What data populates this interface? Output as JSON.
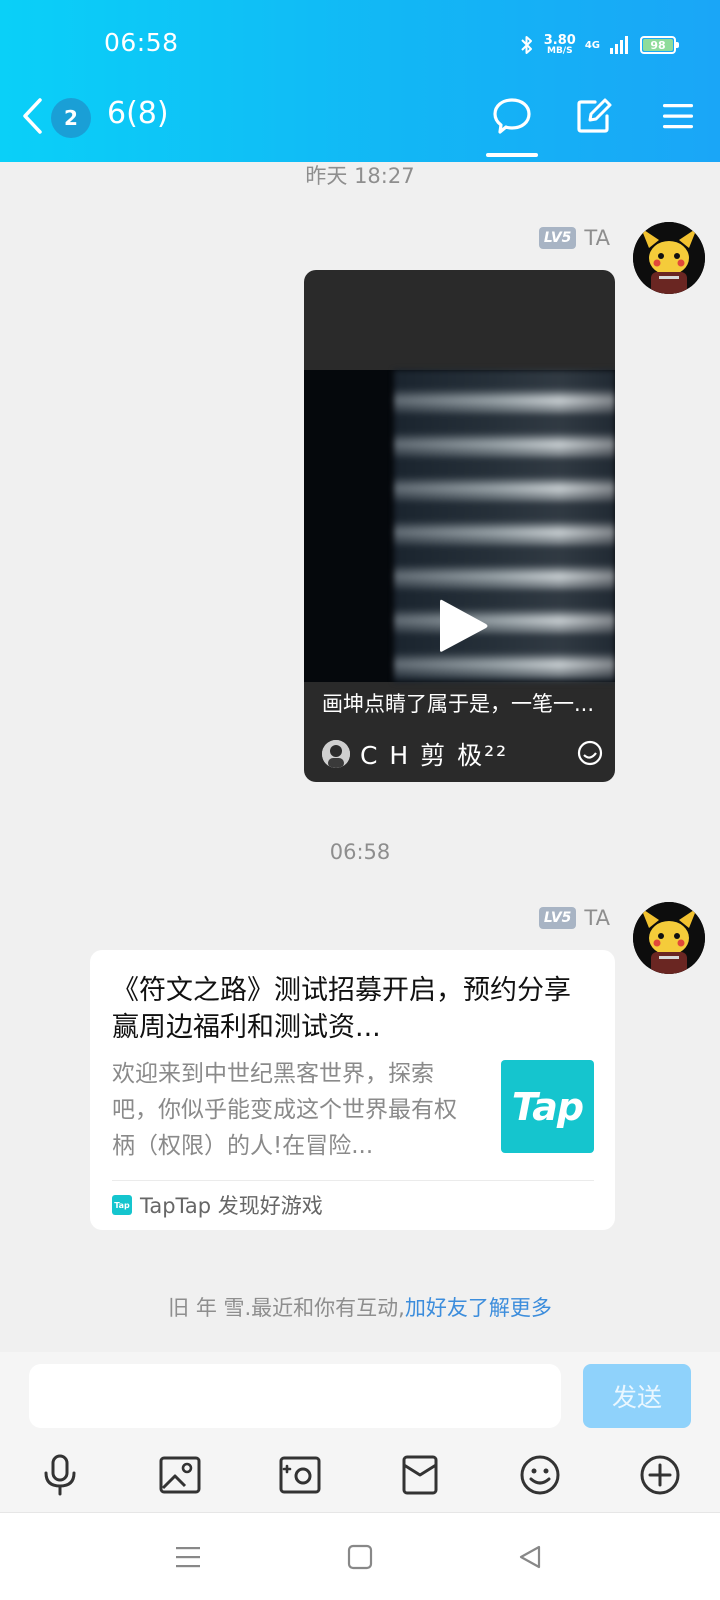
{
  "status_bar": {
    "time": "06:58",
    "speed_value": "3.80",
    "speed_unit": "MB/S",
    "network": "4G",
    "battery": "98"
  },
  "header": {
    "unread_badge": "2",
    "title": "6(8)",
    "icons": [
      "back-chevron-icon",
      "chat-bubble-icon",
      "edit-icon",
      "menu-icon"
    ]
  },
  "messages": [
    {
      "time_label": "昨天 18:27",
      "level": "LV5",
      "sender": "TA",
      "type": "video",
      "caption": "画坤点睛了属于是，一笔一...",
      "author": "C H 剪 极²²"
    },
    {
      "time_label": "06:58",
      "level": "LV5",
      "sender": "TA",
      "type": "link",
      "title": "《符文之路》测试招募开启，预约分享赢周边福利和测试资...",
      "description": "欢迎来到中世纪黑客世界，探索吧，你似乎能变成这个世界最有权柄（权限）的人!在冒险...",
      "thumb_text": "Tap",
      "source_icon_text": "Tap",
      "source": "TapTap 发现好游戏"
    }
  ],
  "tip": {
    "text": "旧 年 雪.最近和你有互动,",
    "link": "加好友了解更多"
  },
  "composer": {
    "input_value": "",
    "send_label": "发送",
    "tools": [
      "microphone-icon",
      "image-icon",
      "camera-icon",
      "red-packet-icon",
      "emoji-icon",
      "plus-icon"
    ]
  },
  "colors": {
    "header_start": "#0ad0f8",
    "header_end": "#1aa6f7",
    "link": "#3c8ddc",
    "send_disabled": "#8fd2fb"
  }
}
